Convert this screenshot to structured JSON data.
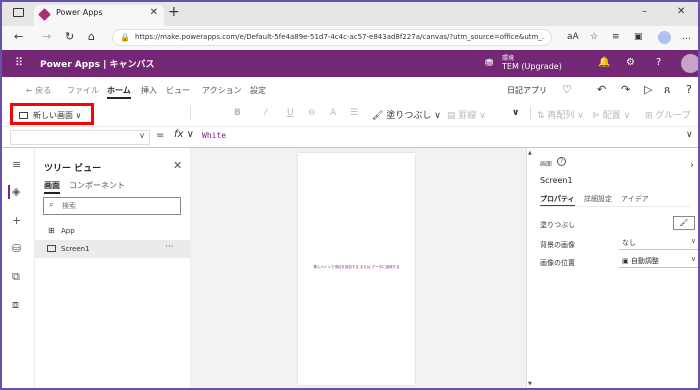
{
  "browser": {
    "tab_title": "Power Apps",
    "tab_close": "✕",
    "new_tab": "+",
    "minimize": "–",
    "close": "✕",
    "url": "https://make.powerapps.com/e/Default-5fe4a89e-51d7-4c4c-ac57-e843ad8f227a/canvas/?utm_source=office&utm_...",
    "toolbar_icons": [
      "read-aloud-icon",
      "favorite-icon",
      "favorites-icon",
      "collections-icon",
      "profile-icon",
      "more-icon"
    ]
  },
  "app": {
    "title": "Power Apps | キャンバス",
    "env_label": "環境",
    "env_name": "TEM (Upgrade)",
    "accent": "#742774"
  },
  "menu": {
    "back": "← 戻る",
    "items": [
      "ファイル",
      "ホーム",
      "挿入",
      "ビュー",
      "アクション",
      "設定"
    ],
    "active": "ホーム",
    "right_text": "日記アプリ"
  },
  "toolbar": {
    "new_screen": "新しい画面 ∨",
    "fill": "塗りつぶし",
    "border": "罫線",
    "reorder": "再配列",
    "align": "配置",
    "group": "グループ"
  },
  "formula": {
    "fx": "fx",
    "eq": "=",
    "value": "White"
  },
  "tree": {
    "title": "ツリー ビュー",
    "tabs": [
      "画面",
      "コンポーネント"
    ],
    "search_placeholder": "検索",
    "items": [
      {
        "label": "App",
        "icon": "app-icon"
      },
      {
        "label": "Screen1",
        "icon": "screen-icon",
        "selected": true
      }
    ]
  },
  "canvas": {
    "hint": "挿入ペインで項目を追加する または データに接続する"
  },
  "properties": {
    "kind": "画面",
    "name": "Screen1",
    "tabs": [
      "プロパティ",
      "詳細設定",
      "アイデア"
    ],
    "rows": [
      {
        "label": "塗りつぶし",
        "value": ""
      },
      {
        "label": "背景の画像",
        "value": "なし"
      },
      {
        "label": "画像の位置",
        "value": "自動調整"
      }
    ]
  }
}
